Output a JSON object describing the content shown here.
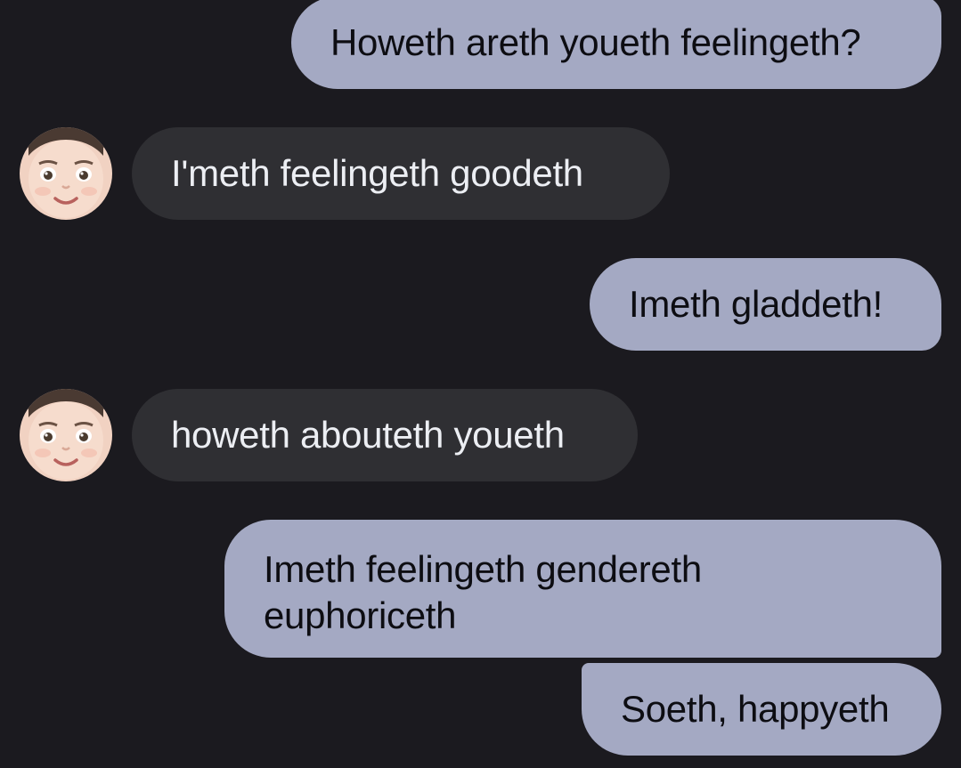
{
  "conversation": {
    "messages": [
      {
        "from": "me",
        "text": "Howeth areth youeth feelingeth?"
      },
      {
        "from": "contact",
        "text": "I'meth feelingeth goodeth"
      },
      {
        "from": "me",
        "text": "Imeth gladdeth!"
      },
      {
        "from": "contact",
        "text": "howeth abouteth youeth"
      },
      {
        "from": "me",
        "text": "Imeth feelingeth gendereth\neuphoriceth"
      },
      {
        "from": "me",
        "text": "Soeth, happyeth"
      }
    ],
    "contact_avatar": "memoji-face-avatar"
  },
  "colors": {
    "background": "#1b1a1f",
    "sent_bubble": "#a4a9c3",
    "received_bubble": "#2f2f33"
  }
}
